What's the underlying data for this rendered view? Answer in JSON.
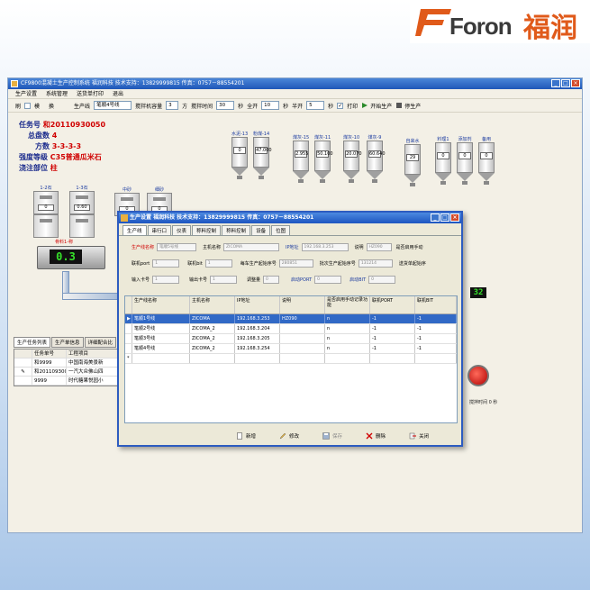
{
  "logo": {
    "brand": "Foron",
    "cn": "福润"
  },
  "window": {
    "title": "CF9800混凝土生产控制系统  福润科技  技术支持：13829999815  传真：0757－88554201"
  },
  "menu": [
    "生产设置",
    "系统管理",
    "送货单打印",
    "退出"
  ],
  "toolbar": {
    "refresh": "刷",
    "mode_label": "模",
    "switch_label": "换",
    "line_label": "生产线",
    "line_value": "笔顺4号线",
    "capacity_label": "搅拌机容量",
    "capacity_value": "3",
    "capacity_unit": "方",
    "mix_time_label": "搅拌时间",
    "mix_time_value": "30",
    "sec1": "秒",
    "fullopen_label": "全开",
    "fullopen_value": "10",
    "sec2": "秒",
    "halfopen_label": "半开",
    "halfopen_value": "5",
    "sec3": "秒",
    "print_label": "打印",
    "start_label": "开始生产",
    "stop_label": "停生产"
  },
  "task": {
    "task_no_label": "任务号",
    "task_no": "和20110930050",
    "plates_label": "总盘数",
    "plates": "4",
    "volume_label": "方数",
    "volume": "3-3-3-3",
    "grade_label": "强度等级",
    "grade": "C35普通瓜米石",
    "part_label": "浇注部位",
    "part": "柱"
  },
  "silos": [
    {
      "label": "水泥-13",
      "value": "0"
    },
    {
      "label": "粉煤-14",
      "value": "47.000"
    },
    {
      "label": "煤灰-15",
      "value": "2.955"
    },
    {
      "label": "煤灰-11",
      "value": "50.100"
    },
    {
      "label": "煤灰-10",
      "value": "20.070"
    },
    {
      "label": "煤灰-9",
      "value": "60.640"
    },
    {
      "label": "自来水",
      "value": "29"
    },
    {
      "label": "料理1",
      "value": "0"
    },
    {
      "label": "添加剂",
      "value": "0"
    },
    {
      "label": "备用",
      "value": "0"
    }
  ],
  "aggregates": [
    {
      "label": "1-2石",
      "value": "0"
    },
    {
      "label": "1-3石",
      "value": "0.60"
    },
    {
      "label": "中砂",
      "value": "0"
    },
    {
      "label": "细砂",
      "value": "0"
    }
  ],
  "hopper_label": "骨料1-称",
  "hopper_led": "0.3",
  "mixer_led": "32",
  "mixer_label": "搅拌时间 0 秒",
  "bottom_tabs": [
    "生产任务列表",
    "生产单信息",
    "详细配合比"
  ],
  "task_table": {
    "headers": [
      "任务单号",
      "工程项目"
    ],
    "rows": [
      {
        "marker": "",
        "id": "和9999",
        "project": "中国南海美景新"
      },
      {
        "marker": "✎",
        "id": "和20110930050",
        "project": "一汽大众佛山四"
      },
      {
        "marker": "",
        "id": "9999",
        "project": "时代糖果悦园小"
      }
    ]
  },
  "dialog": {
    "title": "生产设置    福润科技  技术支持：13829999815  传真：0757－88554201",
    "tabs": [
      "生产线",
      "串行口",
      "仪表",
      "称料控制",
      "称料控制",
      "设备",
      "位图"
    ],
    "form": {
      "line_name_label": "生产线名称",
      "line_name_value": "笔顺5号线",
      "host_label": "主机名称",
      "host_value": "ZICOMA",
      "ip_label": "IP地址",
      "ip_value": "192.168.3.253",
      "desc_label": "说明",
      "desc_value": "HZ090",
      "manual_label": "是否启用手动",
      "port_label": "联机port",
      "port_value": "1",
      "bit_label": "联机bit",
      "bit_value": "1",
      "seq_label": "每车生产起始序号",
      "seq_value": "280851",
      "batch_label": "批次生产起始序号",
      "batch_value": "131214",
      "delivery_label": "送货单起始序",
      "in_label": "输入卡号",
      "in_value": "1",
      "out_label": "输出卡号",
      "out_value": "1",
      "adjust_label": "调整量",
      "adjust_value": "0",
      "startport_label": "启动PORT",
      "startport_value": "0",
      "startbit_label": "启动BIT",
      "startbit_value": "0"
    },
    "grid": {
      "headers": [
        "",
        "生产线名称",
        "主机名称",
        "IP地址",
        "说明",
        "是否启用手动记录功能",
        "联机PORT",
        "联机BIT"
      ],
      "rows": [
        [
          "▶",
          "笔顺1号线",
          "ZICOMA",
          "192.168.3.253",
          "HZ090",
          "n",
          "-1",
          "-1"
        ],
        [
          "",
          "笔顺2号线",
          "ZICOMA_2",
          "192.168.3.204",
          "",
          "n",
          "-1",
          "-1"
        ],
        [
          "",
          "笔顺3号线",
          "ZICOMA_2",
          "192.168.3.205",
          "",
          "n",
          "-1",
          "-1"
        ],
        [
          "",
          "笔顺4号线",
          "ZICOMA_2",
          "192.168.3.254",
          "",
          "n",
          "-1",
          "-1"
        ],
        [
          "*",
          "",
          "",
          "",
          "",
          "",
          "",
          ""
        ]
      ]
    },
    "buttons": {
      "new": "新增",
      "edit": "修改",
      "save": "保存",
      "delete": "删除",
      "close": "关闭"
    }
  },
  "colors": {
    "accent": "#1f57b8",
    "selection": "#3169c6",
    "led": "#36e02a",
    "alert": "#d00000",
    "logo": "#e05a1a"
  }
}
